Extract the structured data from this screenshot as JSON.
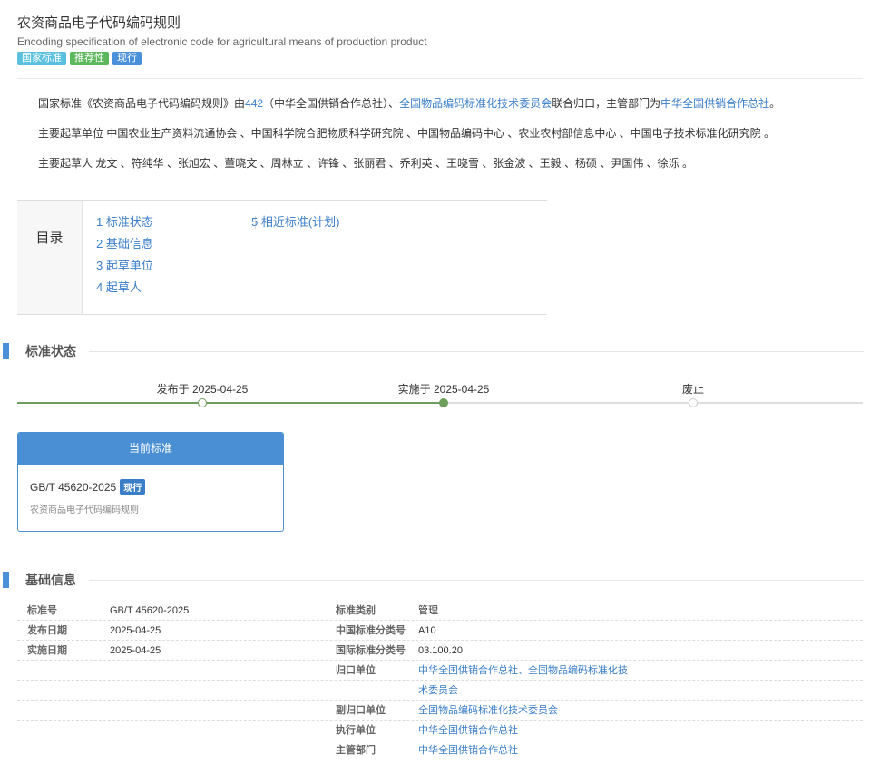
{
  "header": {
    "title": "农资商品电子代码编码规则",
    "subtitle": "Encoding specification of electronic code for agricultural means of production product",
    "badges": [
      {
        "label": "国家标准",
        "color": "#5bc0de"
      },
      {
        "label": "推荐性",
        "color": "#5cb85c"
      },
      {
        "label": "现行",
        "color": "#4a90d9"
      }
    ]
  },
  "intro": {
    "p1_a": "国家标准《农资商品电子代码编码规则》由",
    "p1_link1": "442",
    "p1_b": "（中华全国供销合作总社）、",
    "p1_link2": "全国物品编码标准化技术委员会",
    "p1_c": "联合归口，主管部门为",
    "p1_link3": "中华全国供销合作总社",
    "p1_d": "。",
    "p2": "主要起草单位 中国农业生产资料流通协会 、中国科学院合肥物质科学研究院 、中国物品编码中心 、农业农村部信息中心 、中国电子技术标准化研究院 。",
    "p3": "主要起草人 龙文 、符纯华 、张旭宏 、董晓文 、周林立 、许锋 、张丽君 、乔利英 、王晓雪 、张金波 、王毅 、杨硕 、尹国伟 、徐泺 。"
  },
  "toc": {
    "label": "目录",
    "items": [
      "1  标准状态",
      "2  基础信息",
      "3  起草单位",
      "4  起草人",
      "5  相近标准(计划)"
    ]
  },
  "sections": {
    "status": "标准状态",
    "basic": "基础信息"
  },
  "timeline": {
    "published": "发布于 2025-04-25",
    "implemented": "实施于 2025-04-25",
    "abolished": "废止",
    "colors": {
      "active": "#6e9e5c",
      "track": "#dddddd"
    }
  },
  "current_card": {
    "header": "当前标准",
    "code": "GB/T 45620-2025",
    "status": "现行",
    "name": "农资商品电子代码编码规则"
  },
  "basic_info": {
    "rows": [
      {
        "k1": "标准号",
        "v1": "GB/T 45620-2025",
        "k2": "标准类别",
        "v2": "管理"
      },
      {
        "k1": "发布日期",
        "v1": "2025-04-25",
        "k2": "中国标准分类号",
        "v2": "A10"
      },
      {
        "k1": "实施日期",
        "v1": "2025-04-25",
        "k2": "国际标准分类号",
        "v2": "03.100.20"
      },
      {
        "k1": "",
        "v1": "",
        "k2": "归口单位",
        "v2": "中华全国供销合作总社、全国物品编码标准化技"
      },
      {
        "k1": "",
        "v1": "",
        "k2": "",
        "v2": "术委员会"
      },
      {
        "k1": "",
        "v1": "",
        "k2": "副归口单位",
        "v2": "全国物品编码标准化技术委员会"
      },
      {
        "k1": "",
        "v1": "",
        "k2": "执行单位",
        "v2": "中华全国供销合作总社"
      },
      {
        "k1": "",
        "v1": "",
        "k2": "主管部门",
        "v2": "中华全国供销合作总社"
      }
    ]
  }
}
